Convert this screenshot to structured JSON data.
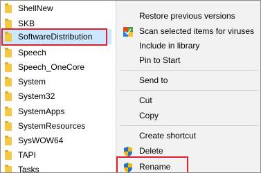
{
  "tree": {
    "items": [
      {
        "label": "ShellNew"
      },
      {
        "label": "SKB"
      },
      {
        "label": "SoftwareDistribution"
      },
      {
        "label": "Speech"
      },
      {
        "label": "Speech_OneCore"
      },
      {
        "label": "System"
      },
      {
        "label": "System32"
      },
      {
        "label": "SystemApps"
      },
      {
        "label": "SystemResources"
      },
      {
        "label": "SysWOW64"
      },
      {
        "label": "TAPI"
      },
      {
        "label": "Tasks"
      }
    ],
    "selected_item": "SoftwareDistribution"
  },
  "context_menu": {
    "items": [
      {
        "label": "Restore previous versions"
      },
      {
        "label": "Scan selected items for viruses",
        "icon": "defender-icon"
      },
      {
        "label": "Include in library"
      },
      {
        "label": "Pin to Start"
      },
      {
        "label": "Send to"
      },
      {
        "label": "Cut"
      },
      {
        "label": "Copy"
      },
      {
        "label": "Create shortcut"
      },
      {
        "label": "Delete",
        "icon": "uac-shield-icon"
      },
      {
        "label": "Rename",
        "icon": "uac-shield-icon"
      }
    ],
    "highlighted_item": "Rename"
  },
  "colors": {
    "highlight_box": "#e0212b",
    "selection": "#cce8ff",
    "menu_background": "#f2f2f2",
    "folder": "#f5c842"
  }
}
